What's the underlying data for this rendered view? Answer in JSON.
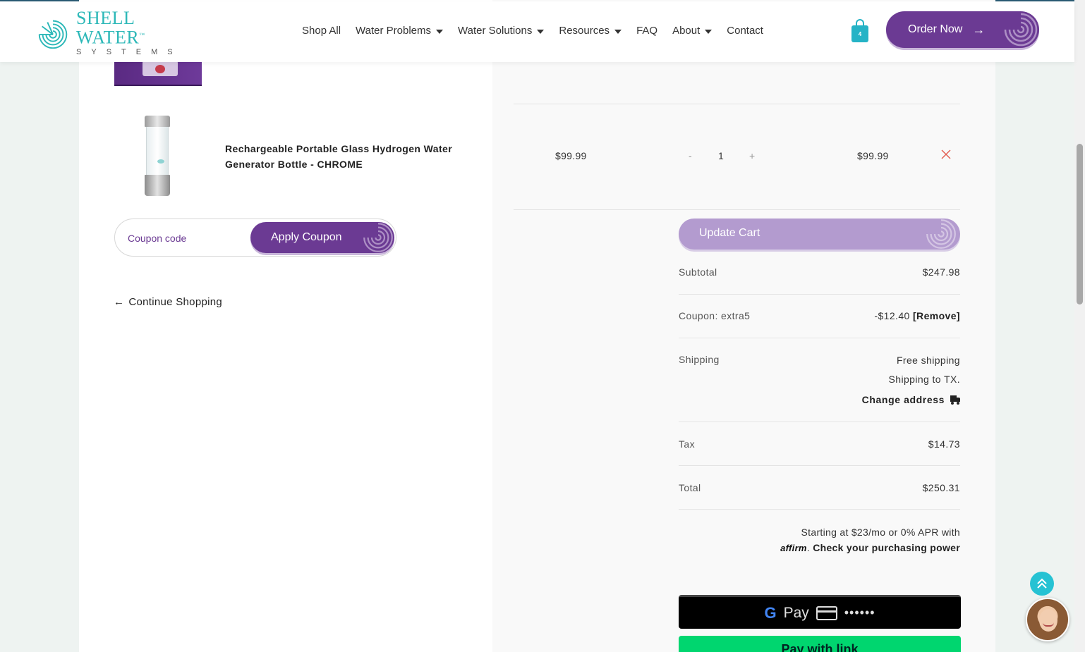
{
  "header": {
    "logo_main": "SHELL WATER",
    "logo_tm": "™",
    "logo_sub": "SYSTEMS",
    "nav": [
      {
        "label": "Shop All",
        "dropdown": false
      },
      {
        "label": "Water Problems",
        "dropdown": true
      },
      {
        "label": "Water Solutions",
        "dropdown": true
      },
      {
        "label": "Resources",
        "dropdown": true
      },
      {
        "label": "FAQ",
        "dropdown": false
      },
      {
        "label": "About",
        "dropdown": true
      },
      {
        "label": "Contact",
        "dropdown": false
      }
    ],
    "cart_count": "4",
    "order_button": "Order Now",
    "order_arrow": "→"
  },
  "cart": {
    "item": {
      "name": "Rechargeable Portable Glass Hydrogen Water Generator Bottle - CHROME",
      "price": "$99.99",
      "qty_minus": "-",
      "qty": "1",
      "qty_plus": "+",
      "subtotal": "$99.99"
    },
    "coupon_placeholder": "Coupon code",
    "apply_coupon": "Apply Coupon",
    "continue_arrow": "←",
    "continue_shopping": "Continue Shopping",
    "update_cart": "Update Cart"
  },
  "totals": {
    "subtotal_label": "Subtotal",
    "subtotal_value": "$247.98",
    "coupon_label": "Coupon: extra5",
    "coupon_value": "-$12.40",
    "coupon_remove": "[Remove]",
    "shipping_label": "Shipping",
    "shipping_method": "Free shipping",
    "shipping_to": "Shipping to TX.",
    "change_address": "Change address",
    "tax_label": "Tax",
    "tax_value": "$14.73",
    "total_label": "Total",
    "total_value": "$250.31"
  },
  "financing": {
    "line1": "Starting at $23/mo or 0% APR with",
    "affirm": "affirm",
    "link": "Check your purchasing power"
  },
  "payment": {
    "gpay_g": "G",
    "gpay_pay": "Pay",
    "gpay_dots": "••••••",
    "link_label": "Pay with link"
  },
  "colors": {
    "brand_purple": "#6b3a93",
    "brand_teal": "#2db8b8",
    "link_green": "#00d66f"
  }
}
